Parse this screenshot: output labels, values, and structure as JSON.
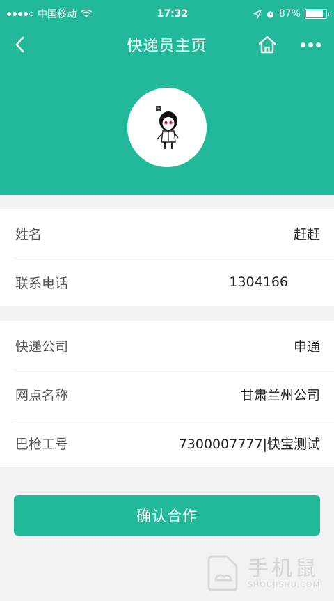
{
  "status_bar": {
    "carrier": "中国移动",
    "time": "17:32",
    "battery_percent": "87%",
    "battery_level": 0.87
  },
  "navbar": {
    "title": "快递员主页"
  },
  "profile": {
    "avatar_icon": "cartoon-avatar"
  },
  "info_group_1": [
    {
      "label": "姓名",
      "value": "赶赶"
    },
    {
      "label": "联系电话",
      "value": "1304166"
    }
  ],
  "info_group_2": [
    {
      "label": "快递公司",
      "value": "申通"
    },
    {
      "label": "网点名称",
      "value": "甘肃兰州公司"
    },
    {
      "label": "巴枪工号",
      "value": "7300007777|快宝测试"
    }
  ],
  "actions": {
    "confirm_label": "确认合作"
  },
  "watermark": {
    "cn": "手机鼠",
    "en": "SHOUJISHU.COM"
  },
  "colors": {
    "brand": "#22b99a",
    "background": "#f2f2f2"
  }
}
